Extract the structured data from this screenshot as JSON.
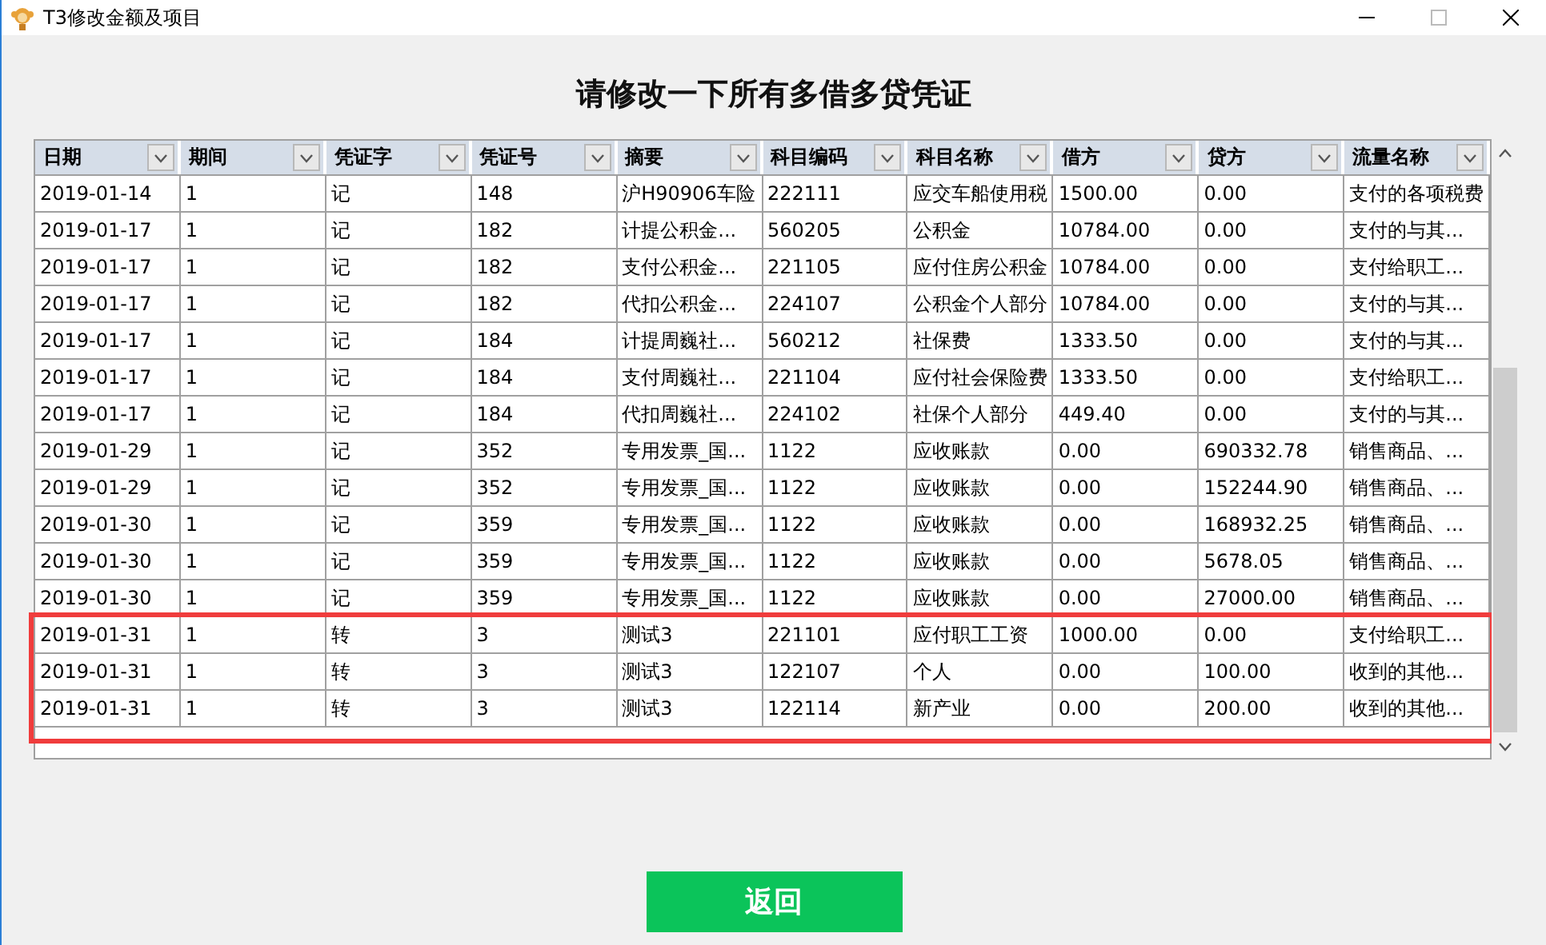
{
  "window": {
    "title": "T3修改金额及项目"
  },
  "heading": "请修改一下所有多借多贷凭证",
  "table": {
    "columns": [
      "日期",
      "期间",
      "凭证字",
      "凭证号",
      "摘要",
      "科目编码",
      "科目名称",
      "借方",
      "贷方",
      "流量名称"
    ],
    "rows": [
      {
        "cells": [
          "2019-01-14",
          "1",
          "记",
          "148",
          "沪H90906车险",
          "222111",
          "应交车船使用税",
          "1500.00",
          "0.00",
          "支付的各项税费"
        ],
        "highlighted": false
      },
      {
        "cells": [
          "2019-01-17",
          "1",
          "记",
          "182",
          "计提公积金...",
          "560205",
          "公积金",
          "10784.00",
          "0.00",
          "支付的与其..."
        ],
        "highlighted": false
      },
      {
        "cells": [
          "2019-01-17",
          "1",
          "记",
          "182",
          "支付公积金...",
          "221105",
          "应付住房公积金",
          "10784.00",
          "0.00",
          "支付给职工..."
        ],
        "highlighted": false
      },
      {
        "cells": [
          "2019-01-17",
          "1",
          "记",
          "182",
          "代扣公积金...",
          "224107",
          "公积金个人部分",
          "10784.00",
          "0.00",
          "支付的与其..."
        ],
        "highlighted": false
      },
      {
        "cells": [
          "2019-01-17",
          "1",
          "记",
          "184",
          "计提周巍社...",
          "560212",
          "社保费",
          "1333.50",
          "0.00",
          "支付的与其..."
        ],
        "highlighted": false
      },
      {
        "cells": [
          "2019-01-17",
          "1",
          "记",
          "184",
          "支付周巍社...",
          "221104",
          "应付社会保险费",
          "1333.50",
          "0.00",
          "支付给职工..."
        ],
        "highlighted": false
      },
      {
        "cells": [
          "2019-01-17",
          "1",
          "记",
          "184",
          "代扣周巍社...",
          "224102",
          "社保个人部分",
          "449.40",
          "0.00",
          "支付的与其..."
        ],
        "highlighted": false
      },
      {
        "cells": [
          "2019-01-29",
          "1",
          "记",
          "352",
          "专用发票_国...",
          "1122",
          "应收账款",
          "0.00",
          "690332.78",
          "销售商品、..."
        ],
        "highlighted": false
      },
      {
        "cells": [
          "2019-01-29",
          "1",
          "记",
          "352",
          "专用发票_国...",
          "1122",
          "应收账款",
          "0.00",
          "152244.90",
          "销售商品、..."
        ],
        "highlighted": false
      },
      {
        "cells": [
          "2019-01-30",
          "1",
          "记",
          "359",
          "专用发票_国...",
          "1122",
          "应收账款",
          "0.00",
          "168932.25",
          "销售商品、..."
        ],
        "highlighted": false
      },
      {
        "cells": [
          "2019-01-30",
          "1",
          "记",
          "359",
          "专用发票_国...",
          "1122",
          "应收账款",
          "0.00",
          "5678.05",
          "销售商品、..."
        ],
        "highlighted": false
      },
      {
        "cells": [
          "2019-01-30",
          "1",
          "记",
          "359",
          "专用发票_国...",
          "1122",
          "应收账款",
          "0.00",
          "27000.00",
          "销售商品、..."
        ],
        "highlighted": false
      },
      {
        "cells": [
          "2019-01-31",
          "1",
          "转",
          "3",
          "测试3",
          "221101",
          "应付职工工资",
          "1000.00",
          "0.00",
          "支付给职工..."
        ],
        "highlighted": true
      },
      {
        "cells": [
          "2019-01-31",
          "1",
          "转",
          "3",
          "测试3",
          "122107",
          "个人",
          "0.00",
          "100.00",
          "收到的其他..."
        ],
        "highlighted": true
      },
      {
        "cells": [
          "2019-01-31",
          "1",
          "转",
          "3",
          "测试3",
          "122114",
          "新产业",
          "0.00",
          "200.00",
          "收到的其他..."
        ],
        "highlighted": true
      }
    ]
  },
  "buttons": [
    {
      "label": "返回"
    }
  ]
}
